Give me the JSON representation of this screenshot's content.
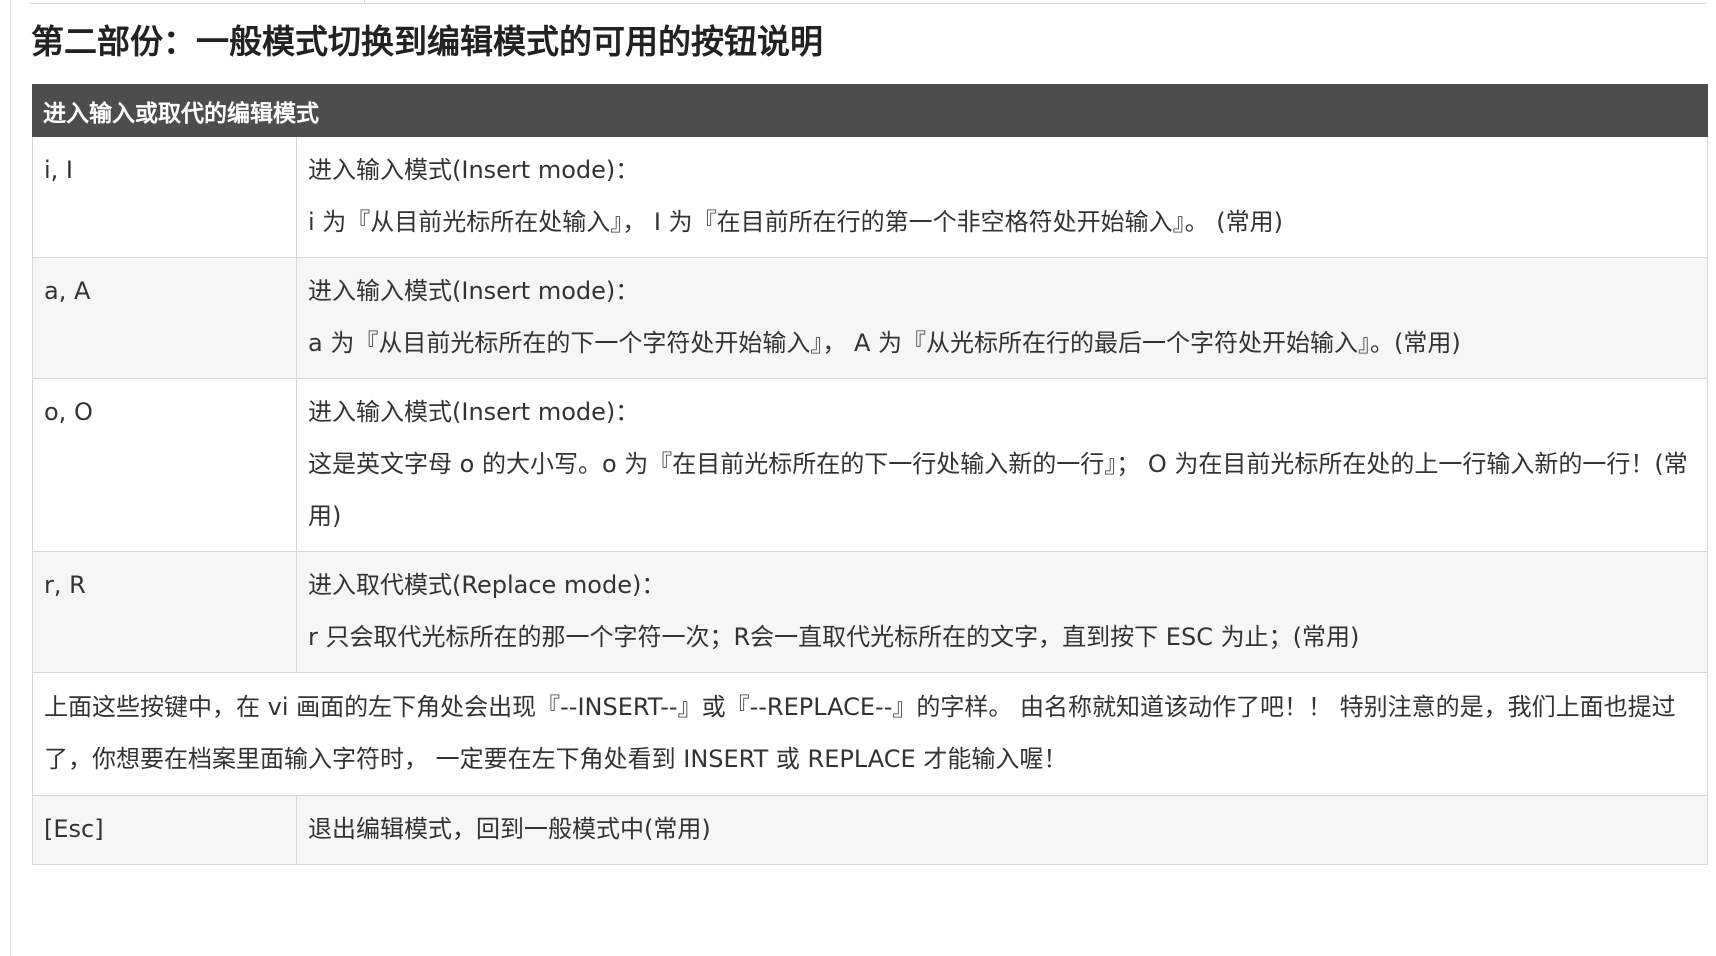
{
  "section": {
    "title": "第二部份：一般模式切换到编辑模式的可用的按钮说明"
  },
  "table": {
    "header": "进入输入或取代的编辑模式",
    "rows": [
      {
        "key": "i, I",
        "lines": [
          "进入输入模式(Insert mode)：",
          "i 为『从目前光标所在处输入』， I 为『在目前所在行的第一个非空格符处开始输入』。 (常用)"
        ]
      },
      {
        "key": "a, A",
        "lines": [
          "进入输入模式(Insert mode)：",
          "a 为『从目前光标所在的下一个字符处开始输入』， A 为『从光标所在行的最后一个字符处开始输入』。(常用)"
        ]
      },
      {
        "key": "o, O",
        "lines": [
          "进入输入模式(Insert mode)：",
          "这是英文字母 o 的大小写。o 为『在目前光标所在的下一行处输入新的一行』； O 为在目前光标所在处的上一行输入新的一行！(常用)"
        ]
      },
      {
        "key": "r, R",
        "lines": [
          "进入取代模式(Replace mode)：",
          "r 只会取代光标所在的那一个字符一次；R会一直取代光标所在的文字，直到按下 ESC 为止；(常用)"
        ]
      }
    ],
    "note": "上面这些按键中，在 vi 画面的左下角处会出现『--INSERT--』或『--REPLACE--』的字样。 由名称就知道该动作了吧！！ 特别注意的是，我们上面也提过了，你想要在档案里面输入字符时， 一定要在左下角处看到 INSERT 或 REPLACE 才能输入喔！",
    "esc_row": {
      "key": "[Esc]",
      "desc": "退出编辑模式，回到一般模式中(常用)"
    }
  }
}
